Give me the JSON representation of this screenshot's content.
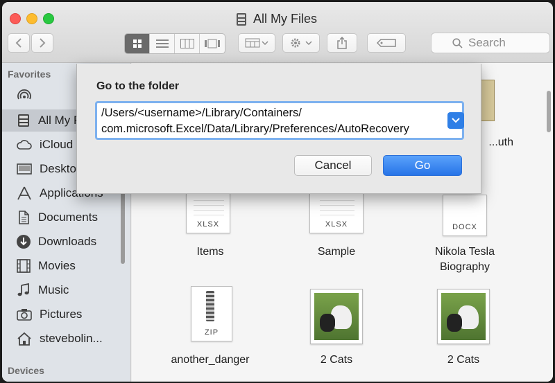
{
  "window": {
    "title": "All My Files"
  },
  "toolbar": {
    "search_placeholder": "Search"
  },
  "sidebar": {
    "favorites_heading": "Favorites",
    "devices_heading": "Devices",
    "items": [
      {
        "label": "",
        "icon": "airdrop-icon"
      },
      {
        "label": "All My Files",
        "icon": "all-files-icon"
      },
      {
        "label": "iCloud Drive",
        "icon": "cloud-icon"
      },
      {
        "label": "Desktop",
        "icon": "desktop-icon"
      },
      {
        "label": "Applications",
        "icon": "applications-icon"
      },
      {
        "label": "Documents",
        "icon": "documents-icon"
      },
      {
        "label": "Downloads",
        "icon": "downloads-icon"
      },
      {
        "label": "Movies",
        "icon": "movies-icon"
      },
      {
        "label": "Music",
        "icon": "music-icon"
      },
      {
        "label": "Pictures",
        "icon": "camera-icon"
      },
      {
        "label": "stevebolin...",
        "icon": "home-icon"
      }
    ]
  },
  "files": [
    {
      "name": "Items",
      "ext": "XLSX"
    },
    {
      "name": "Sample",
      "ext": "XLSX"
    },
    {
      "name": "Nikola Tesla Biography",
      "ext": "DOCX"
    },
    {
      "name": "another_danger",
      "ext": "ZIP"
    },
    {
      "name": "2 Cats",
      "ext": ""
    },
    {
      "name": "2 Cats",
      "ext": ""
    },
    {
      "name": "...uth",
      "ext": ""
    }
  ],
  "dialog": {
    "title": "Go to the folder",
    "path_line1": "/Users/<username>/Library/Containers/",
    "path_line2": "com.microsoft.Excel/Data/Library/Preferences/AutoRecovery",
    "cancel_label": "Cancel",
    "go_label": "Go"
  },
  "colors": {
    "accent": "#2f7fe6",
    "field_focus": "#7db1ef",
    "sidebar_bg": "#dfe3e8"
  }
}
